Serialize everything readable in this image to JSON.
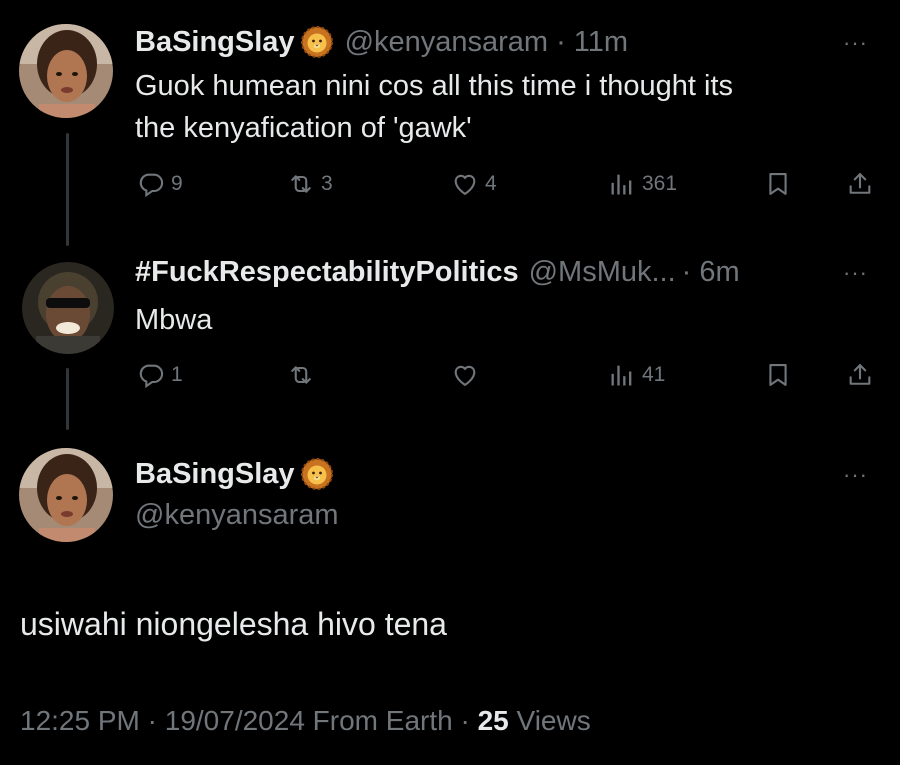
{
  "tweets": [
    {
      "display_name": "BaSingSlay",
      "badge_icon": "lion-emoji-icon",
      "handle": "@kenyansaram",
      "time": "· 11m",
      "text_lines": [
        "Guok humean nini cos all this time i thought its",
        "the kenyafication of 'gawk'"
      ],
      "replies": "9",
      "reposts": "3",
      "likes": "4",
      "views": "361"
    },
    {
      "display_name": "#FuckRespectabilityPolitics",
      "handle": "@MsMuk...",
      "time": "· 6m",
      "text": "Mbwa",
      "replies": "1",
      "reposts": "",
      "likes": "",
      "views": "41"
    }
  ],
  "focused": {
    "display_name": "BaSingSlay",
    "badge_icon": "lion-emoji-icon",
    "handle": "@kenyansaram",
    "text": "usiwahi niongelesha hivo tena",
    "meta": {
      "time": "12:25 PM",
      "date": "19/07/2024",
      "source": "From Earth",
      "views_count": "25",
      "views_label": "Views"
    }
  },
  "more_icon": "···",
  "colors": {
    "background": "#000000",
    "text": "#e7e9ea",
    "muted": "#71767b",
    "thread_line": "#333639"
  }
}
